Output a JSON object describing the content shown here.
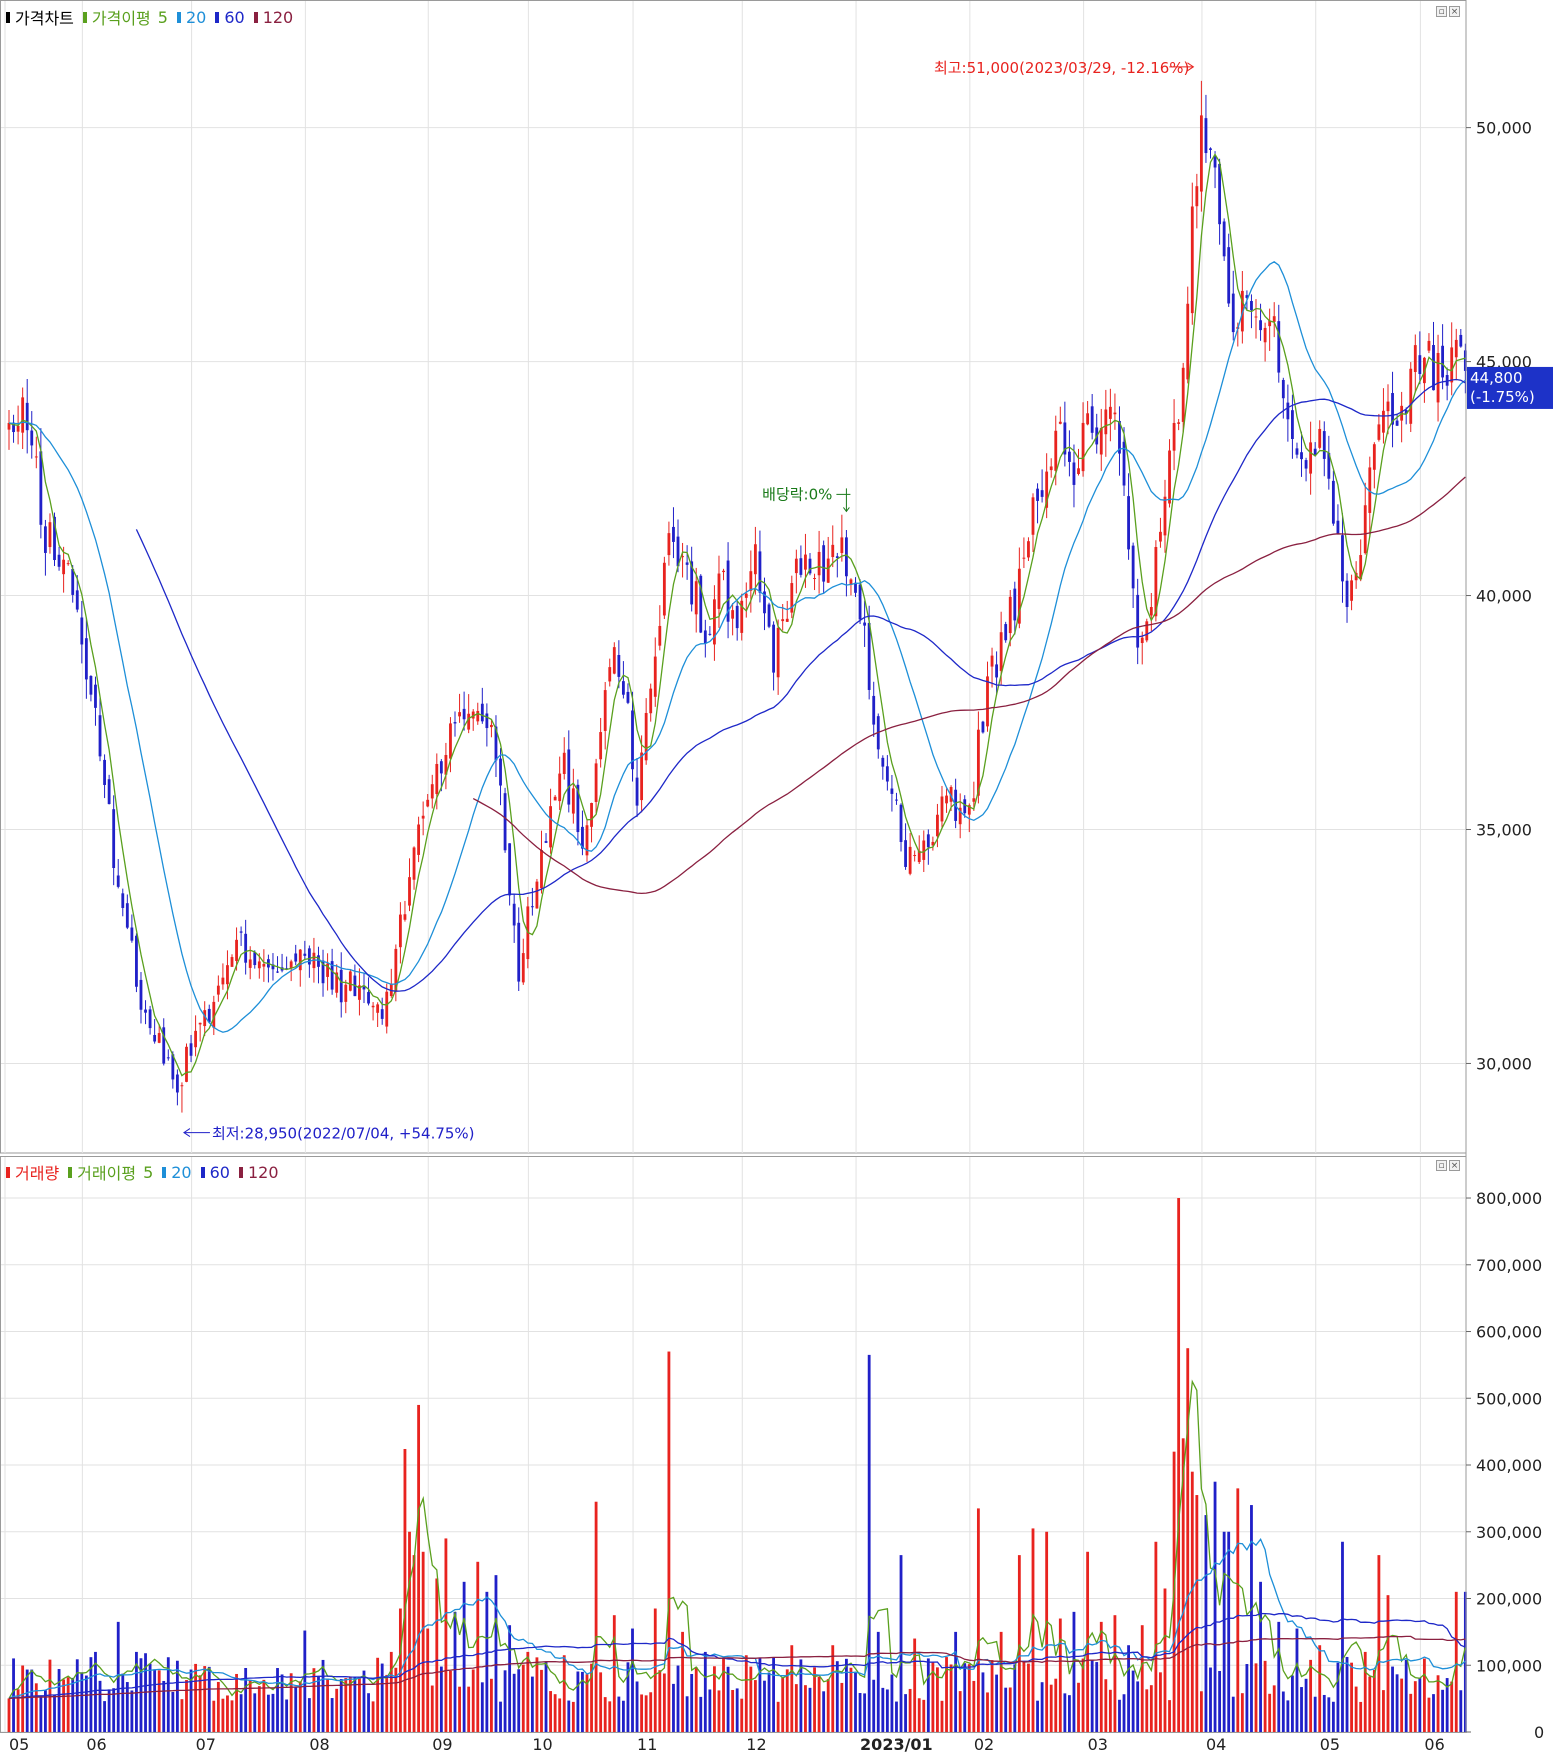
{
  "price_legend": {
    "title": "가격차트",
    "ma_label": "가격이평",
    "p5": "5",
    "p20": "20",
    "p60": "60",
    "p120": "120"
  },
  "volume_legend": {
    "title": "거래량",
    "ma_label": "거래이평",
    "p5": "5",
    "p20": "20",
    "p60": "60",
    "p120": "120"
  },
  "annotations": {
    "high": "최고:51,000(2023/03/29, -12.16%)",
    "low": "최저:28,950(2022/07/04, +54.75%)",
    "dividend": "배당락:0%",
    "current_price": "44,800",
    "current_change": "(-1.75%)"
  },
  "buttons": {
    "minimize": "▫",
    "close": "×"
  },
  "colors": {
    "up": "#e8231f",
    "down": "#2020c8",
    "ma5": "#5aa01e",
    "ma20": "#1e8fd8",
    "ma60": "#1e28c8",
    "ma120": "#8a2040",
    "high_text": "#e8231f",
    "low_text": "#2020c8",
    "dividend_text": "#1a7a1a",
    "badge": "#1d32c8"
  },
  "chart_data": [
    {
      "type": "candlestick",
      "title": "가격차트",
      "ylim": [
        28300,
        52300
      ],
      "yticks": [
        "30,000",
        "35,000",
        "40,000",
        "45,000",
        "50,000"
      ],
      "ytick_values": [
        30000,
        35000,
        40000,
        45000,
        50000
      ],
      "xticks": [
        "05",
        "06",
        "07",
        "08",
        "09",
        "10",
        "11",
        "12",
        "2023/01",
        "02",
        "03",
        "04",
        "05",
        "06"
      ],
      "xtick_day": [
        0,
        17,
        41,
        66,
        93,
        115,
        138,
        162,
        187,
        212,
        237,
        263,
        288,
        311
      ],
      "grid": true,
      "anchors": [
        [
          0,
          43500
        ],
        [
          4,
          43800
        ],
        [
          8,
          41300
        ],
        [
          14,
          40300
        ],
        [
          19,
          37200
        ],
        [
          24,
          33900
        ],
        [
          28,
          31800
        ],
        [
          34,
          30100
        ],
        [
          38,
          29600
        ],
        [
          41,
          30800
        ],
        [
          45,
          31200
        ],
        [
          50,
          32500
        ],
        [
          55,
          32300
        ],
        [
          60,
          32100
        ],
        [
          65,
          32200
        ],
        [
          72,
          31700
        ],
        [
          78,
          31500
        ],
        [
          82,
          31000
        ],
        [
          86,
          32800
        ],
        [
          90,
          35200
        ],
        [
          94,
          36300
        ],
        [
          98,
          37200
        ],
        [
          103,
          37700
        ],
        [
          107,
          36800
        ],
        [
          110,
          33800
        ],
        [
          112,
          32000
        ],
        [
          114,
          33200
        ],
        [
          118,
          35100
        ],
        [
          122,
          36300
        ],
        [
          126,
          34800
        ],
        [
          129,
          36400
        ],
        [
          132,
          38900
        ],
        [
          135,
          38000
        ],
        [
          138,
          35900
        ],
        [
          141,
          37800
        ],
        [
          144,
          40600
        ],
        [
          146,
          41300
        ],
        [
          148,
          40500
        ],
        [
          151,
          40000
        ],
        [
          153,
          38800
        ],
        [
          156,
          40500
        ],
        [
          159,
          39300
        ],
        [
          164,
          40800
        ],
        [
          168,
          38500
        ],
        [
          171,
          39800
        ],
        [
          174,
          40800
        ],
        [
          178,
          40500
        ],
        [
          182,
          41200
        ],
        [
          185,
          40200
        ],
        [
          188,
          38900
        ],
        [
          191,
          36800
        ],
        [
          194,
          35800
        ],
        [
          197,
          34600
        ],
        [
          200,
          34300
        ],
        [
          203,
          35000
        ],
        [
          206,
          35600
        ],
        [
          209,
          35300
        ],
        [
          212,
          36000
        ],
        [
          215,
          38200
        ],
        [
          218,
          38900
        ],
        [
          222,
          40100
        ],
        [
          225,
          41600
        ],
        [
          228,
          43000
        ],
        [
          231,
          43200
        ],
        [
          234,
          42400
        ],
        [
          237,
          43900
        ],
        [
          240,
          43400
        ],
        [
          243,
          44000
        ],
        [
          245,
          42700
        ],
        [
          247,
          39900
        ],
        [
          249,
          38800
        ],
        [
          251,
          40000
        ],
        [
          254,
          42000
        ],
        [
          256,
          43300
        ],
        [
          258,
          45000
        ],
        [
          260,
          48000
        ],
        [
          262,
          49800
        ],
        [
          264,
          50000
        ],
        [
          265,
          48800
        ],
        [
          267,
          47800
        ],
        [
          269,
          45800
        ],
        [
          271,
          46400
        ],
        [
          273,
          46200
        ],
        [
          275,
          45500
        ],
        [
          277,
          46200
        ],
        [
          279,
          45300
        ],
        [
          281,
          44100
        ],
        [
          283,
          43300
        ],
        [
          285,
          42600
        ],
        [
          288,
          43400
        ],
        [
          291,
          42000
        ],
        [
          294,
          40000
        ],
        [
          296,
          40400
        ],
        [
          299,
          43000
        ],
        [
          302,
          44300
        ],
        [
          305,
          43800
        ],
        [
          308,
          44500
        ],
        [
          311,
          45600
        ],
        [
          313,
          44700
        ],
        [
          316,
          44900
        ],
        [
          319,
          45500
        ],
        [
          320,
          44800
        ]
      ],
      "low": {
        "day": 38,
        "value": 28950,
        "date": "2022/07/04"
      },
      "high": {
        "day": 262,
        "value": 51000,
        "date": "2023/03/29"
      },
      "last": {
        "day": 320,
        "value": 44800
      },
      "series": [
        {
          "key": "ma5",
          "period": 5
        },
        {
          "key": "ma20",
          "period": 20
        },
        {
          "key": "ma60",
          "period": 60
        },
        {
          "key": "ma120",
          "period": 120
        }
      ]
    },
    {
      "type": "bar",
      "title": "거래량",
      "ylim": [
        0,
        830000
      ],
      "yticks": [
        "0",
        "100,000",
        "200,000",
        "300,000",
        "400,000",
        "500,000",
        "600,000",
        "700,000",
        "800,000"
      ],
      "ytick_values": [
        0,
        100000,
        200000,
        300000,
        400000,
        500000,
        600000,
        700000,
        800000
      ],
      "spikes": [
        [
          13,
          82000
        ],
        [
          19,
          120000
        ],
        [
          24,
          165000
        ],
        [
          28,
          120000
        ],
        [
          30,
          118000
        ],
        [
          35,
          112000
        ],
        [
          42,
          85000
        ],
        [
          46,
          75000
        ],
        [
          53,
          78000
        ],
        [
          62,
          88000
        ],
        [
          65,
          152000
        ],
        [
          70,
          80000
        ],
        [
          78,
          92000
        ],
        [
          84,
          120000
        ],
        [
          86,
          185000
        ],
        [
          87,
          424000
        ],
        [
          88,
          300000
        ],
        [
          89,
          265000
        ],
        [
          90,
          490000
        ],
        [
          91,
          270000
        ],
        [
          92,
          155000
        ],
        [
          94,
          230000
        ],
        [
          96,
          290000
        ],
        [
          98,
          180000
        ],
        [
          100,
          225000
        ],
        [
          103,
          255000
        ],
        [
          105,
          210000
        ],
        [
          107,
          235000
        ],
        [
          110,
          160000
        ],
        [
          114,
          120000
        ],
        [
          118,
          105000
        ],
        [
          122,
          115000
        ],
        [
          126,
          90000
        ],
        [
          129,
          345000
        ],
        [
          133,
          175000
        ],
        [
          137,
          155000
        ],
        [
          142,
          185000
        ],
        [
          145,
          570000
        ],
        [
          148,
          150000
        ],
        [
          153,
          120000
        ],
        [
          162,
          115000
        ],
        [
          172,
          130000
        ],
        [
          181,
          130000
        ],
        [
          189,
          565000
        ],
        [
          191,
          150000
        ],
        [
          196,
          265000
        ],
        [
          199,
          140000
        ],
        [
          203,
          105000
        ],
        [
          208,
          150000
        ],
        [
          213,
          335000
        ],
        [
          218,
          150000
        ],
        [
          222,
          265000
        ],
        [
          225,
          305000
        ],
        [
          228,
          300000
        ],
        [
          231,
          170000
        ],
        [
          234,
          180000
        ],
        [
          237,
          270000
        ],
        [
          240,
          165000
        ],
        [
          243,
          175000
        ],
        [
          246,
          130000
        ],
        [
          249,
          160000
        ],
        [
          252,
          285000
        ],
        [
          254,
          215000
        ],
        [
          256,
          420000
        ],
        [
          257,
          800000
        ],
        [
          258,
          440000
        ],
        [
          259,
          575000
        ],
        [
          260,
          390000
        ],
        [
          261,
          355000
        ],
        [
          263,
          325000
        ],
        [
          265,
          375000
        ],
        [
          267,
          300000
        ],
        [
          268,
          300000
        ],
        [
          270,
          365000
        ],
        [
          273,
          340000
        ],
        [
          275,
          225000
        ],
        [
          279,
          165000
        ],
        [
          283,
          155000
        ],
        [
          288,
          130000
        ],
        [
          293,
          285000
        ],
        [
          298,
          120000
        ],
        [
          301,
          265000
        ],
        [
          303,
          205000
        ],
        [
          306,
          80000
        ],
        [
          311,
          110000
        ],
        [
          314,
          85000
        ],
        [
          318,
          210000
        ],
        [
          320,
          210000
        ]
      ],
      "base_volume": 75000,
      "series": [
        {
          "key": "ma5",
          "period": 5
        },
        {
          "key": "ma20",
          "period": 20
        },
        {
          "key": "ma60",
          "period": 60
        },
        {
          "key": "ma120",
          "period": 120
        }
      ]
    }
  ]
}
